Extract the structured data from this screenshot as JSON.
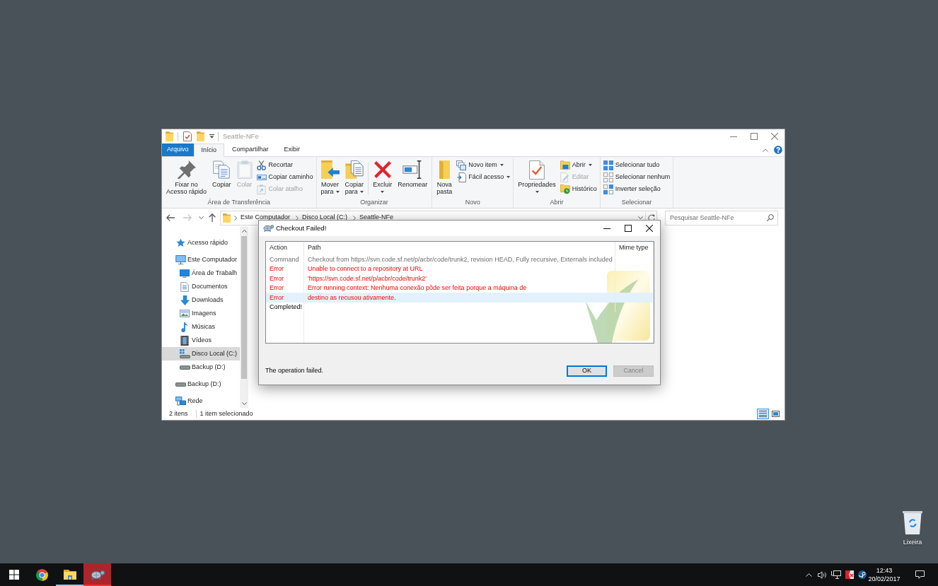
{
  "desktop": {
    "icons": [
      {
        "label": "Lixeira"
      }
    ]
  },
  "explorer": {
    "title": "Seattle-NFe",
    "ribbon": {
      "file_tab": "Arquivo",
      "tabs": [
        {
          "label": "Início",
          "selected": true
        },
        {
          "label": "Compartilhar",
          "selected": false
        },
        {
          "label": "Exibir",
          "selected": false
        }
      ],
      "groups": [
        {
          "label": "Área de Transferência",
          "items": [
            {
              "kind": "large",
              "label": "Fixar no\nAcesso rápido",
              "disabled": false
            },
            {
              "kind": "large",
              "label": "Copiar",
              "disabled": false
            },
            {
              "kind": "large",
              "label": "Colar",
              "disabled": true
            },
            {
              "kind": "small",
              "label": "Recortar",
              "disabled": false
            },
            {
              "kind": "small",
              "label": "Copiar caminho",
              "disabled": false
            },
            {
              "kind": "small",
              "label": "Colar atalho",
              "disabled": true
            }
          ]
        },
        {
          "label": "Organizar",
          "items": [
            {
              "kind": "menu",
              "label": "Mover\npara",
              "disabled": false
            },
            {
              "kind": "menu",
              "label": "Copiar\npara",
              "disabled": false
            },
            {
              "kind": "split",
              "label": "Excluir",
              "disabled": false
            },
            {
              "kind": "large",
              "label": "Renomear",
              "disabled": false
            }
          ]
        },
        {
          "label": "Novo",
          "items": [
            {
              "kind": "large",
              "label": "Nova\npasta",
              "disabled": false
            },
            {
              "kind": "small-menu",
              "label": "Novo item",
              "disabled": false
            },
            {
              "kind": "small-menu",
              "label": "Fácil acesso",
              "disabled": false
            }
          ]
        },
        {
          "label": "Abrir",
          "items": [
            {
              "kind": "split",
              "label": "Propriedades",
              "disabled": false
            },
            {
              "kind": "small-menu",
              "label": "Abrir",
              "disabled": false
            },
            {
              "kind": "small",
              "label": "Editar",
              "disabled": true
            },
            {
              "kind": "small",
              "label": "Histórico",
              "disabled": false
            }
          ]
        },
        {
          "label": "Selecionar",
          "items": [
            {
              "kind": "small",
              "label": "Selecionar tudo",
              "disabled": false
            },
            {
              "kind": "small",
              "label": "Selecionar nenhum",
              "disabled": false
            },
            {
              "kind": "small",
              "label": "Inverter seleção",
              "disabled": false
            }
          ]
        }
      ]
    },
    "navigation": [
      {
        "kind": "back",
        "disabled": false
      },
      {
        "kind": "forward",
        "disabled": true
      },
      {
        "kind": "recent",
        "disabled": false
      },
      {
        "kind": "up",
        "disabled": false
      }
    ],
    "address": {
      "crumbs": [
        "Este Computador",
        "Disco Local (C:)",
        "Seattle-NFe"
      ]
    },
    "search": {
      "placeholder": "Pesquisar Seattle-NFe"
    },
    "sidebar": {
      "items": [
        {
          "kind": "quick-access",
          "label": "Acesso rápido",
          "selected": false
        },
        {
          "kind": "computer",
          "label": "Este Computador",
          "selected": false,
          "children": [
            {
              "kind": "desktop",
              "label": "Área de Trabalh",
              "selected": false
            },
            {
              "kind": "documents",
              "label": "Documentos",
              "selected": false
            },
            {
              "kind": "downloads",
              "label": "Downloads",
              "selected": false
            },
            {
              "kind": "pictures",
              "label": "Imagens",
              "selected": false
            },
            {
              "kind": "music",
              "label": "Músicas",
              "selected": false
            },
            {
              "kind": "videos",
              "label": "Vídeos",
              "selected": false
            },
            {
              "kind": "system-drive",
              "label": "Disco Local (C:)",
              "selected": true
            },
            {
              "kind": "drive",
              "label": "Backup (D:)",
              "selected": false
            }
          ]
        },
        {
          "kind": "drive",
          "label": "Backup (D:)",
          "selected": false
        },
        {
          "kind": "network",
          "label": "Rede",
          "selected": false
        }
      ]
    },
    "status_bar": {
      "item_count": "2 itens",
      "selection": "1 item selecionado"
    },
    "view_buttons": [
      {
        "kind": "details",
        "selected": true
      },
      {
        "kind": "large-icons",
        "selected": false
      }
    ]
  },
  "dialog": {
    "title": "Checkout Failed!",
    "columns": [
      "Action",
      "Path",
      "Mime type"
    ],
    "rows": [
      {
        "kind": "command",
        "action": "Command",
        "path": "Checkout from https://svn.code.sf.net/p/acbr/code/trunk2, revision HEAD, Fully recursive, Externals included",
        "selected": false
      },
      {
        "kind": "error",
        "action": "Error",
        "path": "Unable to connect to a repository at URL",
        "selected": false
      },
      {
        "kind": "error",
        "action": "Error",
        "path": "'https://svn.code.sf.net/p/acbr/code/trunk2'",
        "selected": false
      },
      {
        "kind": "error",
        "action": "Error",
        "path": "Error running context: Nenhuma conexão pôde ser feita porque a máquina de",
        "selected": false
      },
      {
        "kind": "error",
        "action": "Error",
        "path": "destino as recusou ativamente.",
        "selected": true
      },
      {
        "kind": "completed",
        "action": "Completed!",
        "selected": false
      }
    ],
    "message": "The operation failed.",
    "buttons": [
      {
        "label": "OK",
        "default": true,
        "disabled": false
      },
      {
        "label": "Cancel",
        "default": false,
        "disabled": true
      }
    ]
  },
  "taskbar": {
    "apps": [
      {
        "kind": "browser",
        "running": false,
        "attention": false
      },
      {
        "kind": "files",
        "running": true,
        "attention": false
      },
      {
        "kind": "tortoise",
        "running": true,
        "attention": true
      }
    ],
    "clock": {
      "time": "12:43",
      "date": "20/02/2017"
    }
  }
}
